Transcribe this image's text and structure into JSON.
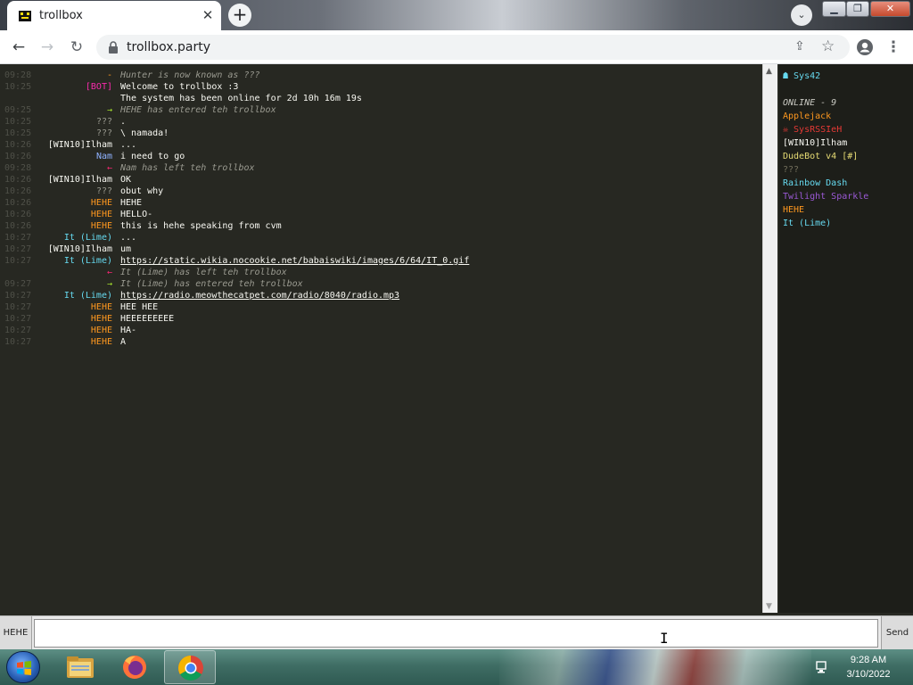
{
  "browser": {
    "tab_title": "trollbox",
    "tab_close": "✕",
    "newtab": "+",
    "url": "trollbox.party",
    "window_close": "✕"
  },
  "messages": [
    {
      "time": "09:28",
      "nick": "-",
      "nick_color": "#fd971f",
      "text": "Hunter is now known as ???",
      "system": true
    },
    {
      "time": "10:25",
      "nick": "[BOT]",
      "nick_color": "#f92aad",
      "text": "Welcome to trollbox :3",
      "system": false
    },
    {
      "time": "",
      "nick": "",
      "nick_color": "#f8f8f2",
      "text": "The system has been online for 2d 10h 16m 19s",
      "system": false
    },
    {
      "time": "09:25",
      "nick": "→",
      "nick_color": "#a6e22e",
      "text": "HEHE has entered teh trollbox",
      "system": true
    },
    {
      "time": "10:25",
      "nick": "???",
      "nick_color": "#9a9a90",
      "text": ".",
      "system": false
    },
    {
      "time": "10:25",
      "nick": "???",
      "nick_color": "#9a9a90",
      "text": "\\ namada!",
      "system": false
    },
    {
      "time": "10:26",
      "nick": "[WIN10]Ilham",
      "nick_color": "#f8f8f2",
      "text": "...",
      "system": false
    },
    {
      "time": "10:26",
      "nick": "Nam",
      "nick_color": "#8fb2ff",
      "text": "i need to go",
      "system": false
    },
    {
      "time": "09:28",
      "nick": "←",
      "nick_color": "#f92672",
      "text": "Nam has left teh trollbox",
      "system": true
    },
    {
      "time": "10:26",
      "nick": "[WIN10]Ilham",
      "nick_color": "#f8f8f2",
      "text": "OK",
      "system": false
    },
    {
      "time": "10:26",
      "nick": "???",
      "nick_color": "#9a9a90",
      "text": "obut why",
      "system": false
    },
    {
      "time": "10:26",
      "nick": "HEHE",
      "nick_color": "#fd971f",
      "text": "HEHE",
      "system": false
    },
    {
      "time": "10:26",
      "nick": "HEHE",
      "nick_color": "#fd971f",
      "text": "HELLO-",
      "system": false
    },
    {
      "time": "10:26",
      "nick": "HEHE",
      "nick_color": "#fd971f",
      "text": "this is hehe speaking from cvm",
      "system": false
    },
    {
      "time": "10:27",
      "nick": "It (Lime)",
      "nick_color": "#66d9ef",
      "text": "...",
      "system": false
    },
    {
      "time": "10:27",
      "nick": "[WIN10]Ilham",
      "nick_color": "#f8f8f2",
      "text": "um",
      "system": false
    },
    {
      "time": "10:27",
      "nick": "It (Lime)",
      "nick_color": "#66d9ef",
      "text": "https://static.wikia.nocookie.net/babaiswiki/images/6/64/IT_0.gif",
      "system": false,
      "link": true
    },
    {
      "time": "",
      "nick": "←",
      "nick_color": "#f92672",
      "text": "It (Lime) has left teh trollbox",
      "system": true
    },
    {
      "time": "09:27",
      "nick": "→",
      "nick_color": "#a6e22e",
      "text": "It (Lime) has entered teh trollbox",
      "system": true
    },
    {
      "time": "10:27",
      "nick": "It (Lime)",
      "nick_color": "#66d9ef",
      "text": "https://radio.meowthecatpet.com/radio/8040/radio.mp3",
      "system": false,
      "link": true
    },
    {
      "time": "10:27",
      "nick": "HEHE",
      "nick_color": "#fd971f",
      "text": "HEE HEE",
      "system": false
    },
    {
      "time": "10:27",
      "nick": "HEHE",
      "nick_color": "#fd971f",
      "text": "HEEEEEEEEE",
      "system": false
    },
    {
      "time": "10:27",
      "nick": "HEHE",
      "nick_color": "#fd971f",
      "text": "HA-",
      "system": false
    },
    {
      "time": "10:27",
      "nick": "HEHE",
      "nick_color": "#fd971f",
      "text": "A",
      "system": false
    }
  ],
  "sidebar": {
    "channel": "☗ Sys42",
    "online_label": "ONLINE - 9",
    "users": [
      {
        "name": "Applejack",
        "color": "#fd971f"
      },
      {
        "name": "☠ SysRSSIeH",
        "color": "#e53935"
      },
      {
        "name": "[WIN10]Ilham",
        "color": "#f8f8f2"
      },
      {
        "name": "DudeBot v4 [#]",
        "color": "#e6db74"
      },
      {
        "name": "???",
        "color": "#75715e"
      },
      {
        "name": "Rainbow Dash",
        "color": "#66d9ef"
      },
      {
        "name": "Twilight Sparkle",
        "color": "#9b59d6"
      },
      {
        "name": "HEHE",
        "color": "#fd971f"
      },
      {
        "name": "It (Lime)",
        "color": "#66d9ef"
      }
    ]
  },
  "inputbar": {
    "nick": "HEHE",
    "placeholder": "",
    "send_label": "Send"
  },
  "taskbar": {
    "time": "9:28 AM",
    "date": "3/10/2022"
  }
}
